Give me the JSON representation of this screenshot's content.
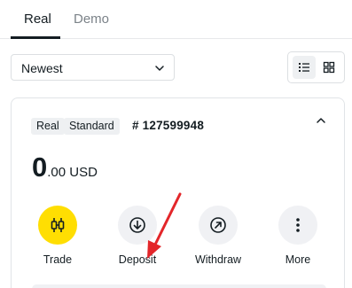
{
  "tabs": [
    {
      "label": "Real",
      "active": true
    },
    {
      "label": "Demo",
      "active": false
    }
  ],
  "sort": {
    "selected": "Newest"
  },
  "view_toggle": {
    "active": "list",
    "icons": [
      "list-view-icon",
      "grid-view-icon"
    ]
  },
  "account": {
    "badges": [
      "Real",
      "Standard"
    ],
    "number": "# 127599948",
    "balance_int": "0",
    "balance_rest": ".00 USD"
  },
  "actions": [
    {
      "label": "Trade",
      "icon": "trade-candles-icon"
    },
    {
      "label": "Deposit",
      "icon": "arrow-down-circle-icon"
    },
    {
      "label": "Withdraw",
      "icon": "arrow-up-right-circle-icon"
    },
    {
      "label": "More",
      "icon": "more-vertical-icon"
    }
  ],
  "colors": {
    "accent_yellow": "#ffde02",
    "text": "#141d22",
    "muted_text": "#7b8288",
    "annotation_red": "#e3262a"
  }
}
